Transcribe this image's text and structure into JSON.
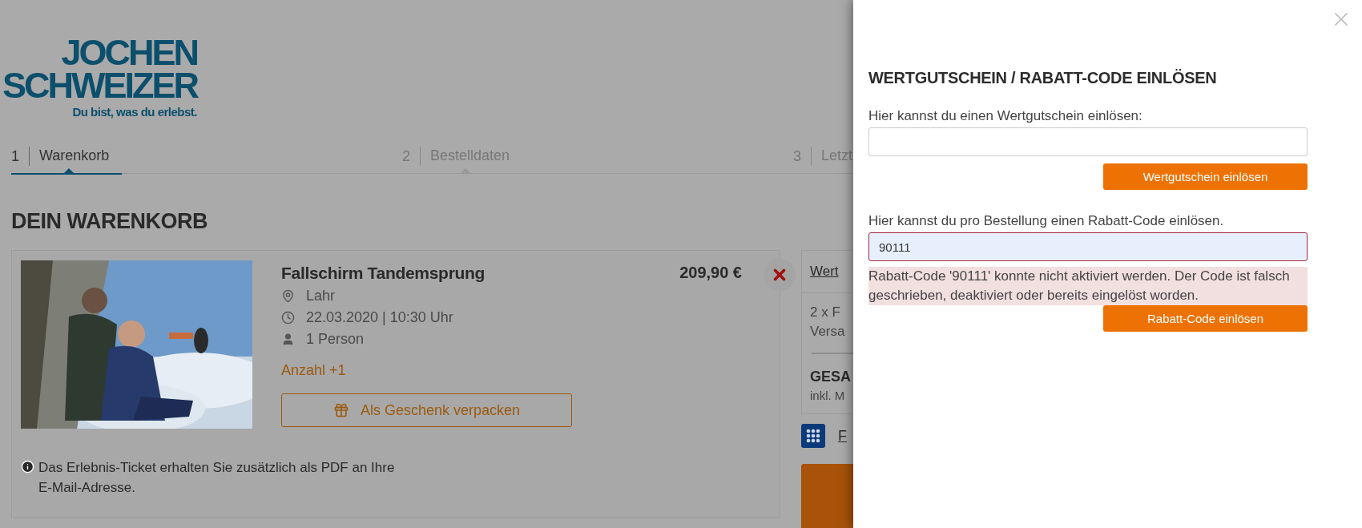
{
  "logo": {
    "line_1": "JOCHEN",
    "line_2": "SCHWEIZER",
    "tagline": "Du bist, was du erlebst."
  },
  "steps": [
    {
      "number": "1",
      "label": "Warenkorb",
      "selected": true
    },
    {
      "number": "2",
      "label": "Bestelldaten",
      "selected": false
    },
    {
      "number": "3",
      "label": "Letzt",
      "selected": false
    }
  ],
  "page_title": "DEIN WARENKORB",
  "cart_item": {
    "title": "Fallschirm Tandemsprung",
    "price": "209,90 €",
    "details": [
      {
        "kind": "location",
        "text": "Lahr"
      },
      {
        "kind": "time",
        "text": "22.03.2020 | 10:30 Uhr"
      },
      {
        "kind": "person",
        "text": "1 Person"
      }
    ],
    "quantity_link": "Anzahl +1",
    "gift_button": "Als Geschenk verpacken",
    "note": "Das Erlebnis-Ticket erhalten Sie zusätzlich als PDF an Ihre E-Mail-Adresse."
  },
  "summary": {
    "link": "Wert",
    "lines": [
      "2 x F",
      "Versa"
    ],
    "total_label": "GESA",
    "tax_note": "inkl. M",
    "payment_link": "F"
  },
  "drawer": {
    "title": "WERTGUTSCHEIN / RABATT-CODE EINLÖSEN",
    "voucher": {
      "label": "Hier kannst du einen Wertgutschein einlösen:",
      "button": "Wertgutschein einlösen"
    },
    "discount": {
      "label": "Hier kannst du pro Bestellung einen Rabatt-Code einlösen.",
      "value": "90111",
      "invalid": true,
      "error": "Rabatt-Code '90111' konnte nicht aktiviert werden. Der Code ist falsch geschrieben, deaktiviert oder bereits eingelöst worden.",
      "button": "Rabatt-Code einlösen"
    }
  }
}
